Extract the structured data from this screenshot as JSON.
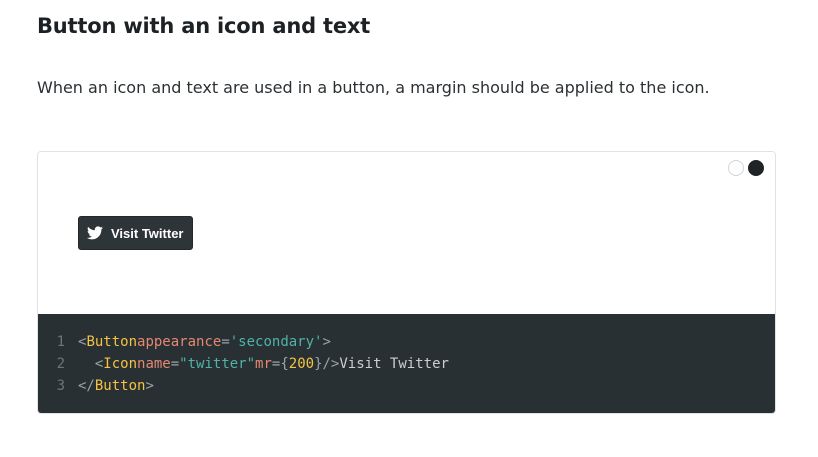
{
  "section": {
    "title": "Button with an icon and text",
    "description": "When an icon and text are used in a button, a margin should be applied to the icon."
  },
  "theme_toggle": {
    "options": [
      "light",
      "dark"
    ],
    "selected": "dark"
  },
  "preview": {
    "button_label": "Visit Twitter",
    "button_icon": "twitter-icon"
  },
  "code": {
    "line_numbers": [
      "1",
      "2",
      "3"
    ],
    "l1_lt": "<",
    "l1_tag": "Button",
    "l1_attr": "appearance",
    "l1_eq": "=",
    "l1_val": "'secondary'",
    "l1_gt": ">",
    "l2_indent": "  ",
    "l2_lt": "<",
    "l2_tag": "Icon",
    "l2_attr1": "name",
    "l2_eq1": "=",
    "l2_val1": "\"twitter\"",
    "l2_attr2": "mr",
    "l2_eq2": "=",
    "l2_brace_open": "{",
    "l2_num": "200",
    "l2_brace_close": "}",
    "l2_close": "/>",
    "l2_text": "Visit Twitter",
    "l3_lt": "</",
    "l3_tag": "Button",
    "l3_gt": ">"
  },
  "colors": {
    "code_background": "#293033",
    "button_background": "#2e3538",
    "jsx_tag": "#f5c343",
    "jsx_attr": "#e48872",
    "jsx_string": "#4fb3a6"
  }
}
